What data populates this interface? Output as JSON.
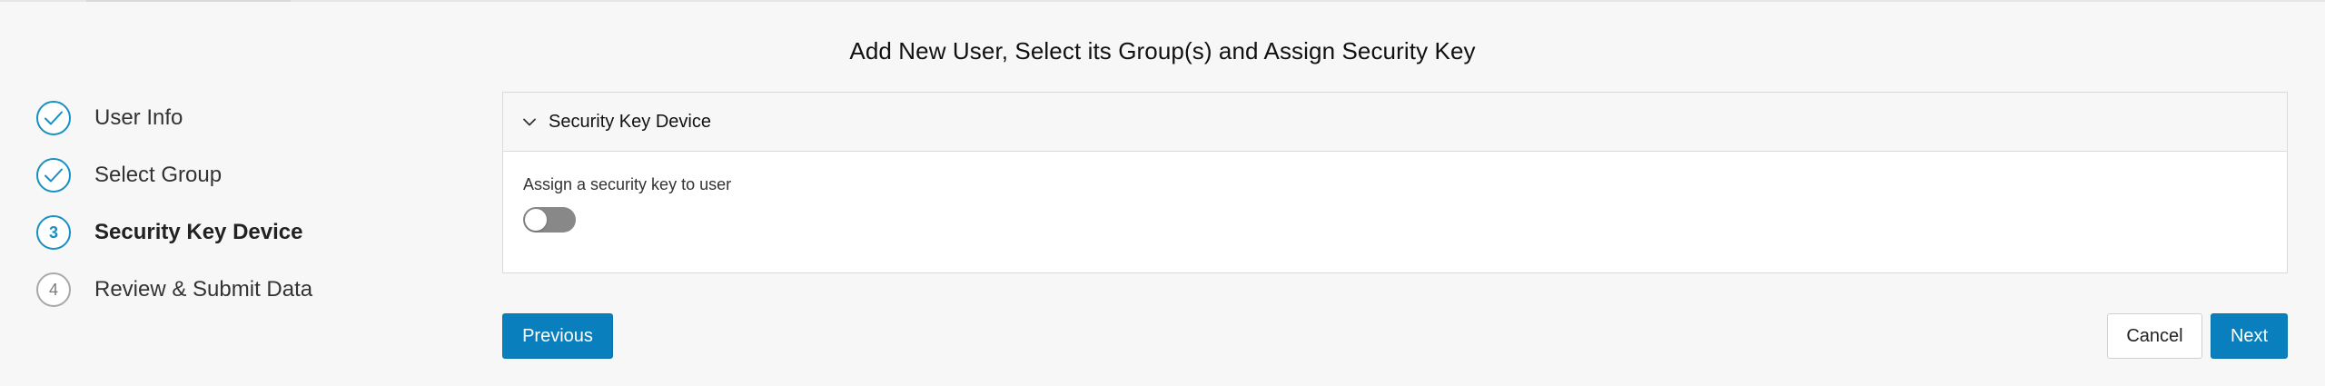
{
  "page": {
    "title": "Add New User, Select its Group(s) and Assign Security Key"
  },
  "stepper": {
    "steps": [
      {
        "label": "User Info",
        "number": "1",
        "status": "completed"
      },
      {
        "label": "Select Group",
        "number": "2",
        "status": "completed"
      },
      {
        "label": "Security Key Device",
        "number": "3",
        "status": "active"
      },
      {
        "label": "Review & Submit Data",
        "number": "4",
        "status": "pending"
      }
    ]
  },
  "panel": {
    "title": "Security Key Device",
    "expanded": true,
    "toggle_label": "Assign a security key to user",
    "toggle_on": false
  },
  "buttons": {
    "previous": "Previous",
    "cancel": "Cancel",
    "next": "Next"
  },
  "colors": {
    "accent": "#0a7fbd",
    "completed_step": "#1a8fc2",
    "pending_step": "#a8a8a8",
    "toggle_off": "#888888",
    "background": "#f7f7f7"
  },
  "icons": {
    "completed_step": "check-icon",
    "panel_header": "chevron-down-icon"
  }
}
